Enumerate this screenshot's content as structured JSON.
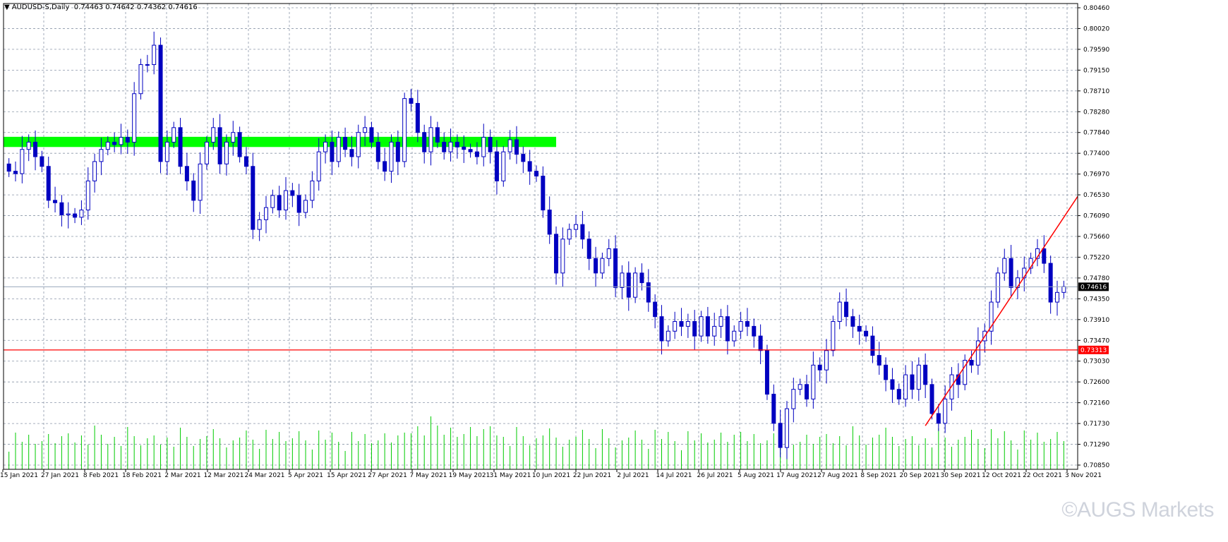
{
  "header": {
    "symbol": "AUDUSD-S",
    "timeframe": "Daily",
    "ohlc": "0.74463 0.74642 0.74362 0.74616"
  },
  "watermark": "©AUGS Markets",
  "chart_data": {
    "type": "candlestick",
    "title": "AUDUSD-S,Daily",
    "price_axis_ticks": [
      "0.80460",
      "0.80020",
      "0.79590",
      "0.79150",
      "0.78710",
      "0.78280",
      "0.77840",
      "0.77400",
      "0.76970",
      "0.76530",
      "0.76090",
      "0.75660",
      "0.75220",
      "0.74780",
      "0.74350",
      "0.73910",
      "0.73470",
      "0.73030",
      "0.72600",
      "0.72160",
      "0.71730",
      "0.71290",
      "0.70850"
    ],
    "ylim": [
      0.7085,
      0.8046
    ],
    "date_axis_labels": [
      "15 Jan 2021",
      "27 Jan 2021",
      "8 Feb 2021",
      "18 Feb 2021",
      "2 Mar 2021",
      "12 Mar 2021",
      "24 Mar 2021",
      "5 Apr 2021",
      "15 Apr 2021",
      "27 Apr 2021",
      "7 May 2021",
      "19 May 2021",
      "31 May 2021",
      "10 Jun 2021",
      "22 Jun 2021",
      "2 Jul 2021",
      "14 Jul 2021",
      "26 Jul 2021",
      "5 Aug 2021",
      "17 Aug 2021",
      "27 Aug 2021",
      "8 Sep 2021",
      "20 Sep 2021",
      "30 Sep 2021",
      "12 Oct 2021",
      "22 Oct 2021",
      "3 Nov 2021"
    ],
    "current_price_label": "0.74616",
    "horizontal_line_label": "0.73313",
    "horizontal_line_price": 0.73313,
    "current_price": 0.74616,
    "resistance_zone": {
      "from": 0.775,
      "to": 0.7771,
      "start_date": "15 Jan 2021",
      "end_date": "10 Jun 2021",
      "color": "#00ff00"
    },
    "trendline": {
      "start_date": "30 Sep 2021",
      "start_price": 0.7175,
      "end_price": 0.7648,
      "color": "#ff0000"
    },
    "grid": true,
    "volume_color": "#00cc00",
    "candle_color": "#0000c0",
    "closes": [
      0.77,
      0.7695,
      0.7745,
      0.776,
      0.773,
      0.771,
      0.764,
      0.7635,
      0.761,
      0.7612,
      0.7605,
      0.762,
      0.768,
      0.772,
      0.7745,
      0.776,
      0.7755,
      0.777,
      0.776,
      0.786,
      0.792,
      0.792,
      0.796,
      0.772,
      0.776,
      0.779,
      0.771,
      0.768,
      0.764,
      0.7715,
      0.776,
      0.779,
      0.7715,
      0.776,
      0.778,
      0.773,
      0.771,
      0.758,
      0.76,
      0.7625,
      0.765,
      0.762,
      0.766,
      0.765,
      0.7615,
      0.764,
      0.768,
      0.774,
      0.776,
      0.772,
      0.777,
      0.7745,
      0.773,
      0.778,
      0.779,
      0.776,
      0.772,
      0.77,
      0.776,
      0.772,
      0.785,
      0.784,
      0.778,
      0.774,
      0.779,
      0.776,
      0.774,
      0.776,
      0.775,
      0.7745,
      0.774,
      0.773,
      0.777,
      0.774,
      0.768,
      0.774,
      0.7765,
      0.7735,
      0.772,
      0.77,
      0.769,
      0.762,
      0.757,
      0.749,
      0.756,
      0.758,
      0.759,
      0.756,
      0.752,
      0.749,
      0.752,
      0.754,
      0.746,
      0.749,
      0.744,
      0.749,
      0.747,
      0.743,
      0.74,
      0.735,
      0.737,
      0.739,
      0.738,
      0.739,
      0.736,
      0.74,
      0.736,
      0.738,
      0.74,
      0.735,
      0.737,
      0.739,
      0.738,
      0.736,
      0.733,
      0.724,
      0.718,
      0.713,
      0.721,
      0.725,
      0.726,
      0.723,
      0.73,
      0.729,
      0.733,
      0.739,
      0.743,
      0.74,
      0.738,
      0.737,
      0.736,
      0.732,
      0.73,
      0.727,
      0.725,
      0.723,
      0.728,
      0.725,
      0.73,
      0.726,
      0.72,
      0.718,
      0.723,
      0.728,
      0.726,
      0.731,
      0.73,
      0.735,
      0.737,
      0.743,
      0.749,
      0.752,
      0.746,
      0.748,
      0.75,
      0.752,
      0.754,
      0.751,
      0.743,
      0.745,
      0.7462
    ]
  }
}
